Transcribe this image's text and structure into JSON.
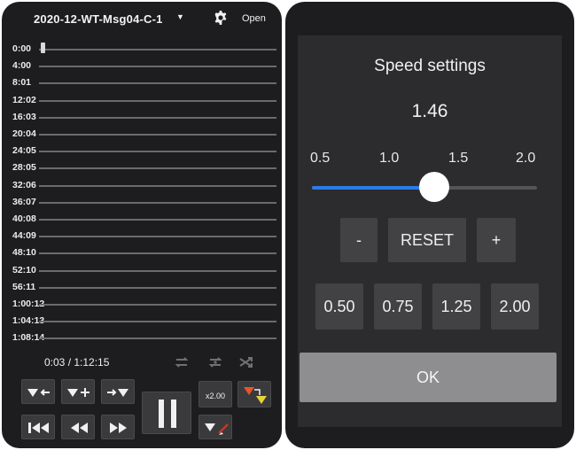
{
  "player": {
    "file_name": "2020-12-WT-Msg04-C-1",
    "open_label": "Open",
    "track_times": [
      "0:00",
      "4:00",
      "8:01",
      "12:02",
      "16:03",
      "20:04",
      "24:05",
      "28:05",
      "32:06",
      "36:07",
      "40:08",
      "44:09",
      "48:10",
      "52:10",
      "56:11",
      "1:00:12",
      "1:04:13",
      "1:08:14"
    ],
    "elapsed": "0:03 / 1:12:15",
    "speed_badge": "x2.00",
    "icons": {
      "dropdown": "chevron-down-icon",
      "settings": "gear-icon",
      "modes": [
        "repeat-icon",
        "repeat-one-icon",
        "shuffle-icon"
      ],
      "controls_row1": [
        "mark-back-icon",
        "mark-add-icon",
        "mark-forward-icon"
      ],
      "controls_row2": [
        "skip-to-start-icon",
        "rewind-icon",
        "fast-forward-icon"
      ],
      "main": "pause-icon",
      "extra": [
        "marker-swap-icon",
        "marker-remove-icon"
      ]
    },
    "colors": {
      "background": "#1d1d1f",
      "button": "#3a3a3c",
      "marker_orange": "#e8542a",
      "marker_yellow": "#e6d23a"
    }
  },
  "speed_dialog": {
    "title": "Speed settings",
    "current_value": "1.46",
    "value_numeric": 1.46,
    "slider_min": 0.5,
    "slider_max": 2.0,
    "tick_labels": [
      "0.5",
      "1.0",
      "1.5",
      "2.0"
    ],
    "minus_label": "-",
    "reset_label": "RESET",
    "plus_label": "+",
    "presets": [
      "0.50",
      "0.75",
      "1.25",
      "2.00"
    ],
    "ok_label": "OK",
    "colors": {
      "dialog": "#2c2c2e",
      "accent": "#2e7be8",
      "ok_button": "#8e8e90"
    }
  }
}
